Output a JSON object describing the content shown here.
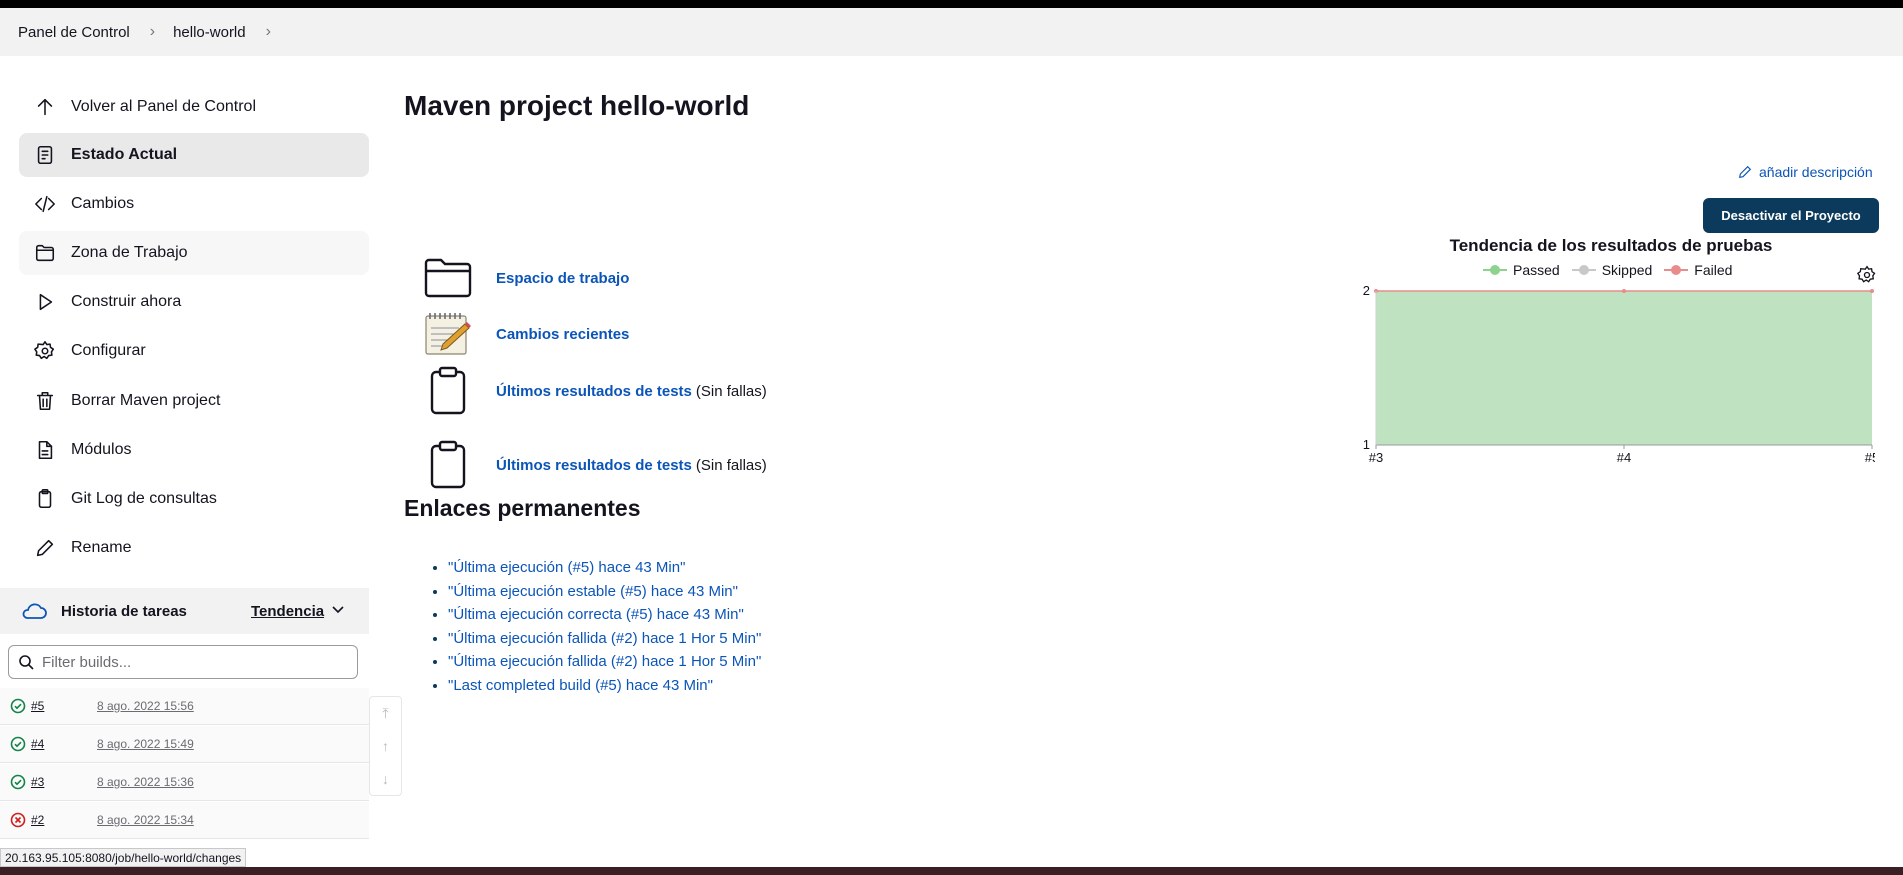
{
  "breadcrumb": [
    "Panel de Control",
    "hello-world"
  ],
  "sidebar": {
    "items": [
      {
        "label": "Volver al Panel de Control",
        "icon": "arrow-up-icon"
      },
      {
        "label": "Estado Actual",
        "icon": "document-icon"
      },
      {
        "label": "Cambios",
        "icon": "code-icon"
      },
      {
        "label": "Zona de Trabajo",
        "icon": "folder-icon"
      },
      {
        "label": "Construir ahora",
        "icon": "play-icon"
      },
      {
        "label": "Configurar",
        "icon": "gear-icon"
      },
      {
        "label": "Borrar Maven project",
        "icon": "trash-icon"
      },
      {
        "label": "Módulos",
        "icon": "file-icon"
      },
      {
        "label": "Git Log de consultas",
        "icon": "clipboard-icon"
      },
      {
        "label": "Rename",
        "icon": "pencil-icon"
      }
    ]
  },
  "history": {
    "title": "Historia de tareas",
    "trend": "Tendencia",
    "filter_placeholder": "Filter builds...",
    "builds": [
      {
        "num": "#5",
        "date": "8 ago. 2022 15:56",
        "status": "success"
      },
      {
        "num": "#4",
        "date": "8 ago. 2022 15:49",
        "status": "success"
      },
      {
        "num": "#3",
        "date": "8 ago. 2022 15:36",
        "status": "success"
      },
      {
        "num": "#2",
        "date": "8 ago. 2022 15:34",
        "status": "failed"
      }
    ]
  },
  "main": {
    "title": "Maven project hello-world",
    "add_description": "añadir descripción",
    "disable_button": "Desactivar el Proyecto",
    "links": [
      {
        "label": "Espacio de trabajo",
        "suffix": ""
      },
      {
        "label": "Cambios recientes",
        "suffix": ""
      },
      {
        "label": "Últimos resultados de tests",
        "suffix": "(Sin fallas)"
      },
      {
        "label": "Últimos resultados de tests",
        "suffix": "(Sin fallas)"
      }
    ],
    "permalinks_title": "Enlaces permanentes",
    "permalinks": [
      "\"Última ejecución (#5) hace 43 Min\"",
      "\"Última ejecución estable (#5) hace 43 Min\"",
      "\"Última ejecución correcta (#5) hace 43 Min\"",
      "\"Última ejecución fallida (#2) hace 1 Hor 5 Min\"",
      "\"Última ejecución fallida (#2) hace 1 Hor 5 Min\"",
      "\"Last completed build (#5) hace 43 Min\""
    ]
  },
  "chart_data": {
    "type": "area",
    "title": "Tendencia de los resultados de pruebas",
    "x": [
      "#3",
      "#4",
      "#5"
    ],
    "series": [
      {
        "name": "Passed",
        "values": [
          2,
          2,
          2
        ],
        "color": "#8cd38e"
      },
      {
        "name": "Skipped",
        "values": [
          0,
          0,
          0
        ],
        "color": "#c8c8c8"
      },
      {
        "name": "Failed",
        "values": [
          0,
          0,
          0
        ],
        "color": "#e88c8c"
      }
    ],
    "ylim": [
      1,
      2
    ],
    "yticks": [
      "2",
      "1"
    ],
    "legend": "top"
  },
  "status_bar_url": "20.163.95.105:8080/job/hello-world/changes"
}
